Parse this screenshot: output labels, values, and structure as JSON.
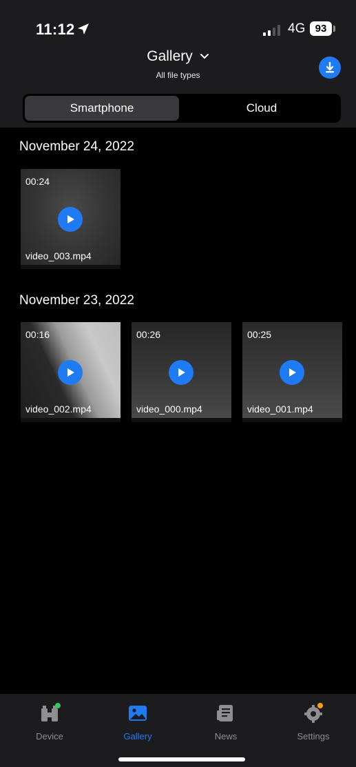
{
  "status_bar": {
    "time": "11:12",
    "network": "4G",
    "battery": "93"
  },
  "header": {
    "title": "Gallery",
    "subtitle": "All file types"
  },
  "segments": {
    "smartphone": "Smartphone",
    "cloud": "Cloud"
  },
  "groups": [
    {
      "date": "November 24, 2022",
      "videos": [
        {
          "duration": "00:24",
          "filename": "video_003.mp4"
        }
      ]
    },
    {
      "date": "November 23, 2022",
      "videos": [
        {
          "duration": "00:16",
          "filename": "video_002.mp4"
        },
        {
          "duration": "00:26",
          "filename": "video_000.mp4"
        },
        {
          "duration": "00:25",
          "filename": "video_001.mp4"
        }
      ]
    }
  ],
  "tabs": [
    {
      "label": "Device",
      "icon": "binoculars-icon"
    },
    {
      "label": "Gallery",
      "icon": "image-icon"
    },
    {
      "label": "News",
      "icon": "newspaper-icon"
    },
    {
      "label": "Settings",
      "icon": "gear-icon"
    }
  ],
  "colors": {
    "accent": "#1e7bf4",
    "background": "#000000",
    "bar": "#1c1c1e",
    "device_badge": "#34c759",
    "settings_badge": "#ff9f0a"
  }
}
